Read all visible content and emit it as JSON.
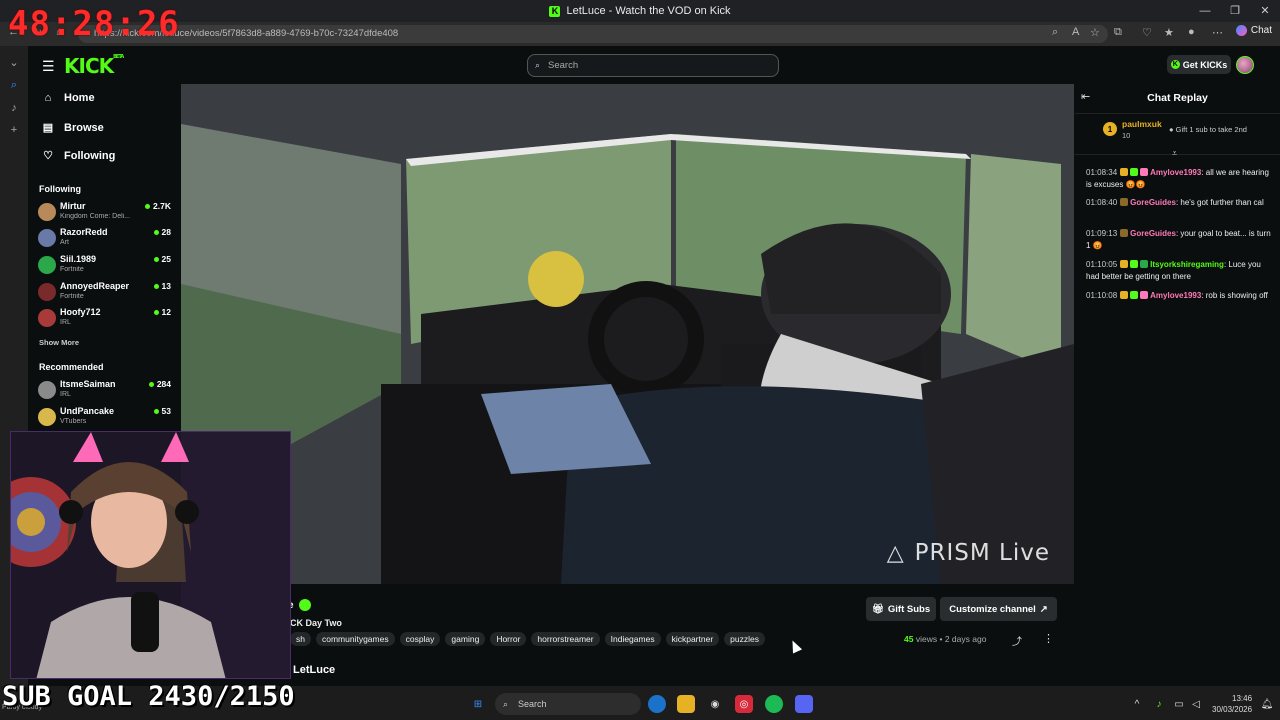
{
  "browser": {
    "window_title": "LetLuce - Watch the VOD on Kick",
    "url": "https://kick.com/letluce/videos/5f7863d8-a889-4769-b70c-73247dfde408",
    "chat_button": "Chat",
    "window_controls": [
      "—",
      "❐",
      "✕"
    ]
  },
  "overlay": {
    "timer": "48:28:26",
    "sub_goal": "SUB GOAL 2430/2150"
  },
  "header": {
    "logo": "KICK",
    "logo_sup": "BETA",
    "search_placeholder": "Search",
    "get_kicks": "Get KICKs"
  },
  "sidebar": {
    "nav": [
      {
        "label": "Home",
        "icon": "home-icon"
      },
      {
        "label": "Browse",
        "icon": "browse-icon"
      },
      {
        "label": "Following",
        "icon": "heart-icon"
      }
    ],
    "following_title": "Following",
    "following": [
      {
        "name": "Mirtur",
        "category": "Kingdom Come: Deli...",
        "viewers": "2.7K",
        "color": "#b88a5a"
      },
      {
        "name": "RazorRedd",
        "category": "Art",
        "viewers": "28",
        "color": "#6a7aa8"
      },
      {
        "name": "Siil.1989",
        "category": "Fortnite",
        "viewers": "25",
        "color": "#2aa84a"
      },
      {
        "name": "AnnoyedReaper",
        "category": "Fortnite",
        "viewers": "13",
        "color": "#7a2a2a"
      },
      {
        "name": "Hoofy712",
        "category": "IRL",
        "viewers": "12",
        "color": "#a83a3a"
      }
    ],
    "show_more": "Show More",
    "recommended_title": "Recommended",
    "recommended": [
      {
        "name": "ItsmeSaiman",
        "category": "IRL",
        "viewers": "284",
        "color": "#8a8a8a"
      },
      {
        "name": "UndPancake",
        "category": "VTubers",
        "viewers": "53",
        "color": "#d8b84a"
      }
    ]
  },
  "video": {
    "watermark": "PRISM Live"
  },
  "info": {
    "title_fragment": "e",
    "stream_title": "CK Day Two",
    "tags": [
      "sh",
      "communitygames",
      "cosplay",
      "gaming",
      "Horror",
      "horrorstreamer",
      "Indiegames",
      "kickpartner",
      "puzzles"
    ],
    "gift_subs": "Gift Subs",
    "customize": "Customize channel",
    "views_count": "45",
    "views_label": "views",
    "age": "2 days ago",
    "channel": "LetLuce"
  },
  "chat": {
    "title": "Chat Replay",
    "pinned_user": "paulmxuk",
    "pinned_count": "10",
    "pinned_rank": "1",
    "pinned_action": "Gift 1 sub to take 2nd",
    "messages": [
      {
        "time": "01:08:34",
        "user": "Amylove1993",
        "color": "#ff7ab8",
        "text": ": all we are hearing is excuses 😡😡"
      },
      {
        "time": "01:08:40",
        "user": "GoreGuides",
        "color": "#ff7ab8",
        "text": ": he's got further than cal"
      },
      {
        "time": "01:09:13",
        "user": "GoreGuides",
        "color": "#ff7ab8",
        "text": ": your goal to beat... is turn 1 😡"
      },
      {
        "time": "01:10:05",
        "user": "Itsyorkshiregaming",
        "color": "#53fc18",
        "text": ": Luce you had better be getting on there"
      },
      {
        "time": "01:10:08",
        "user": "Amylove1993",
        "color": "#ff7ab8",
        "text": ": rob is showing off"
      }
    ]
  },
  "taskbar": {
    "search": "Search",
    "time": "13:46",
    "date": "30/03/2026",
    "weather": "Partly cloudy"
  }
}
